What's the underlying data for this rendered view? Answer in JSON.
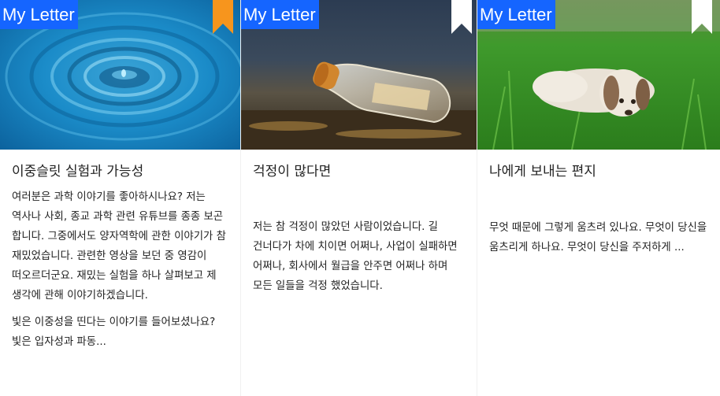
{
  "brand_label": "My Letter",
  "colors": {
    "brand_bg": "#1565ff",
    "bookmark_active": "#f7951d",
    "bookmark_default": "#ffffff"
  },
  "cards": [
    {
      "image": "water-droplet-ripple",
      "bookmark_icon": "bookmark-filled-orange",
      "title": "이중슬릿 실험과 가능성",
      "paragraphs": [
        "여러분은 과학 이야기를 좋아하시나요? 저는 역사나 사회, 종교 과학 관련 유튜브를 종종 보곤 합니다. 그중에서도 양자역학에 관한 이야기가 참 재밌었습니다. 관련한 영상을 보던 중 영감이 떠오르더군요. 재밌는 실험을 하나 살펴보고 제 생각에 관해 이야기하겠습니다.",
        "빛은 이중성을 띤다는 이야기를 들어보셨나요? 빛은 입자성과 파동..."
      ]
    },
    {
      "image": "message-in-a-bottle",
      "bookmark_icon": "bookmark-white",
      "title": "걱정이 많다면",
      "paragraphs": [
        " 저는 참 걱정이 많았던 사람이었습니다. 길 건너다가 차에 치이면 어쩌나, 사업이 실패하면 어쩌나, 회사에서 월급을 안주면 어쩌나 하며 모든 일들을 걱정 했었습니다."
      ]
    },
    {
      "image": "puppy-on-grass",
      "bookmark_icon": "bookmark-white",
      "title": "나에게 보내는 편지",
      "paragraphs": [
        " 무엇 때문에 그렇게 움츠려 있나요. 무엇이 당신을 움츠리게 하나요. 무엇이 당신을 주저하게 ..."
      ]
    }
  ]
}
